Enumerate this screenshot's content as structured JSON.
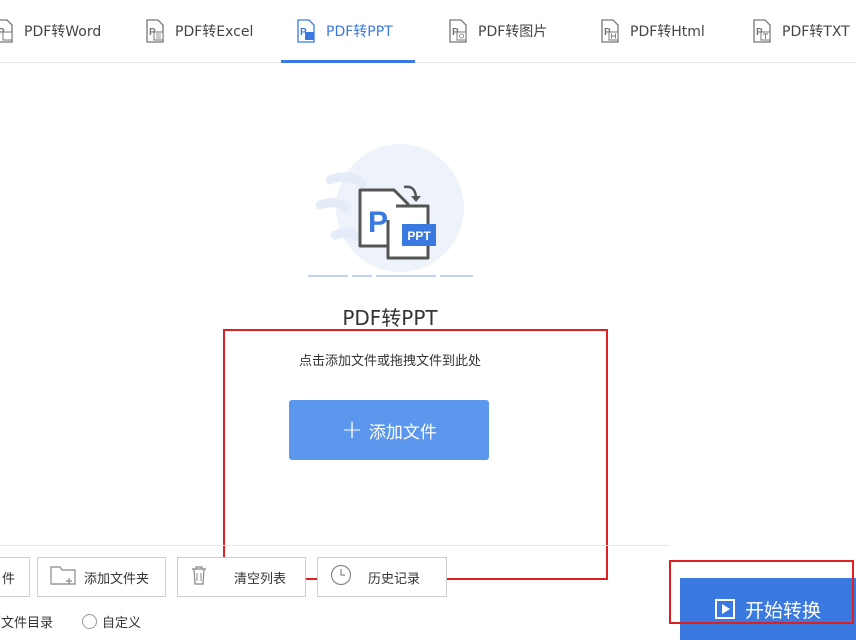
{
  "tabs": [
    {
      "label": "PDF转Word",
      "icon": "word-icon",
      "letter": "W"
    },
    {
      "label": "PDF转Excel",
      "icon": "excel-icon",
      "letter": "E"
    },
    {
      "label": "PDF转PPT",
      "icon": "ppt-icon",
      "letter": "P",
      "active": true
    },
    {
      "label": "PDF转图片",
      "icon": "image-icon",
      "letter": "I"
    },
    {
      "label": "PDF转Html",
      "icon": "html-icon",
      "letter": "H"
    },
    {
      "label": "PDF转TXT",
      "icon": "txt-icon",
      "letter": "T"
    }
  ],
  "hero": {
    "title": "PDF转PPT",
    "hint": "点击添加文件或拖拽文件到此处",
    "ppt_badge": "PPT",
    "p_letter": "P"
  },
  "add_button": {
    "plus": "+",
    "label": "添加文件"
  },
  "toolbar": {
    "partial_label": "件",
    "add_folder": "添加文件夹",
    "clear_list": "清空列表",
    "history": "历史记录"
  },
  "options": {
    "source_dir": "原文件目录",
    "custom": "自定义"
  },
  "start_button": {
    "label": "开始转换"
  },
  "colors": {
    "accent": "#3a79e0",
    "button": "#5b97ec",
    "highlight": "#e02020"
  }
}
